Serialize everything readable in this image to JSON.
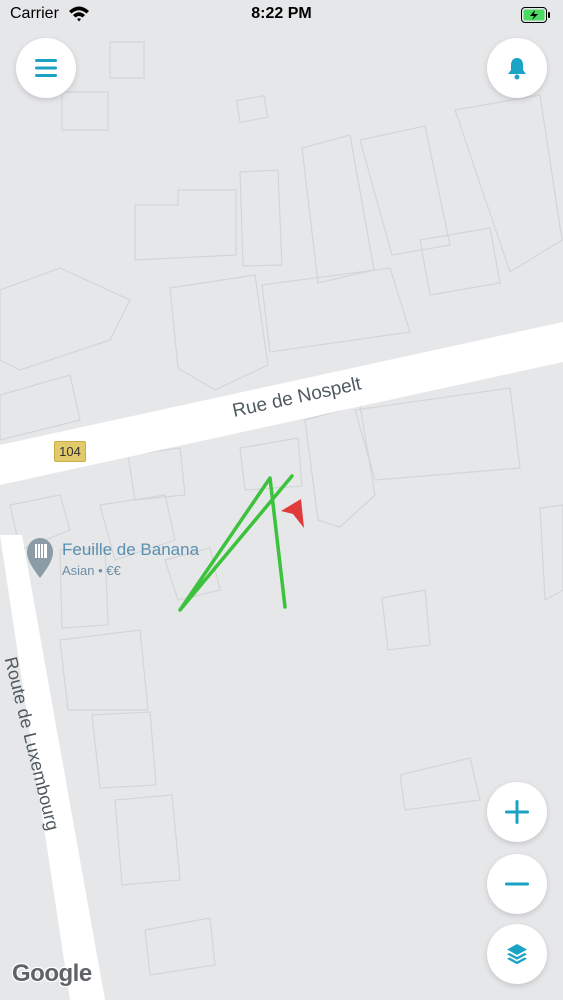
{
  "status_bar": {
    "carrier": "Carrier",
    "time": "8:22 PM"
  },
  "map": {
    "streets": [
      {
        "name": "Rue de Nospelt"
      },
      {
        "name": "Route de Luxembourg"
      }
    ],
    "route_shield": "104",
    "poi": {
      "name": "Feuille de Banana",
      "category": "Asian • €€",
      "icon": "restaurant-icon"
    },
    "track_color": "#3cc23c",
    "marker_color": "#e03a3a",
    "attribution": "Google"
  },
  "controls": {
    "menu_icon": "menu-icon",
    "notification_icon": "bell-icon",
    "zoom_in_icon": "plus-icon",
    "zoom_out_icon": "minus-icon",
    "layers_icon": "layers-icon",
    "accent_color": "#1ba3c6"
  }
}
